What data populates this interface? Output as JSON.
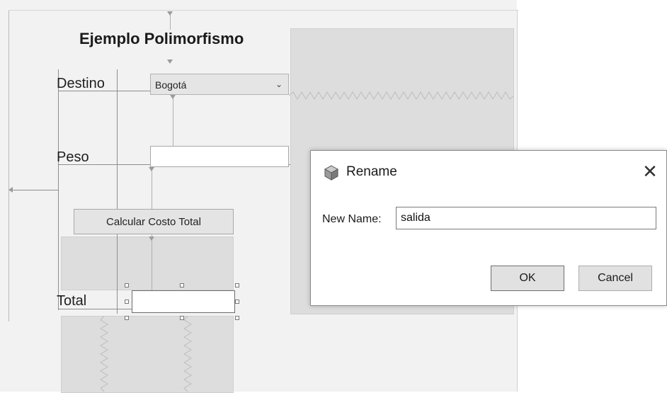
{
  "form": {
    "title": "Ejemplo Polimorfismo",
    "destino_label": "Destino",
    "destino_value": "Bogotá",
    "peso_label": "Peso",
    "peso_value": "",
    "calc_button_label": "Calcular Costo Total",
    "total_label": "Total",
    "total_value": ""
  },
  "dialog": {
    "title": "Rename",
    "close_glyph": "✕",
    "new_name_label": "New Name:",
    "new_name_value": "salida",
    "ok_label": "OK",
    "cancel_label": "Cancel",
    "icon": "cube-icon"
  },
  "icons": {
    "combo_arrow": "chevron-down-icon",
    "combo_arrow_glyph": "⌄"
  }
}
